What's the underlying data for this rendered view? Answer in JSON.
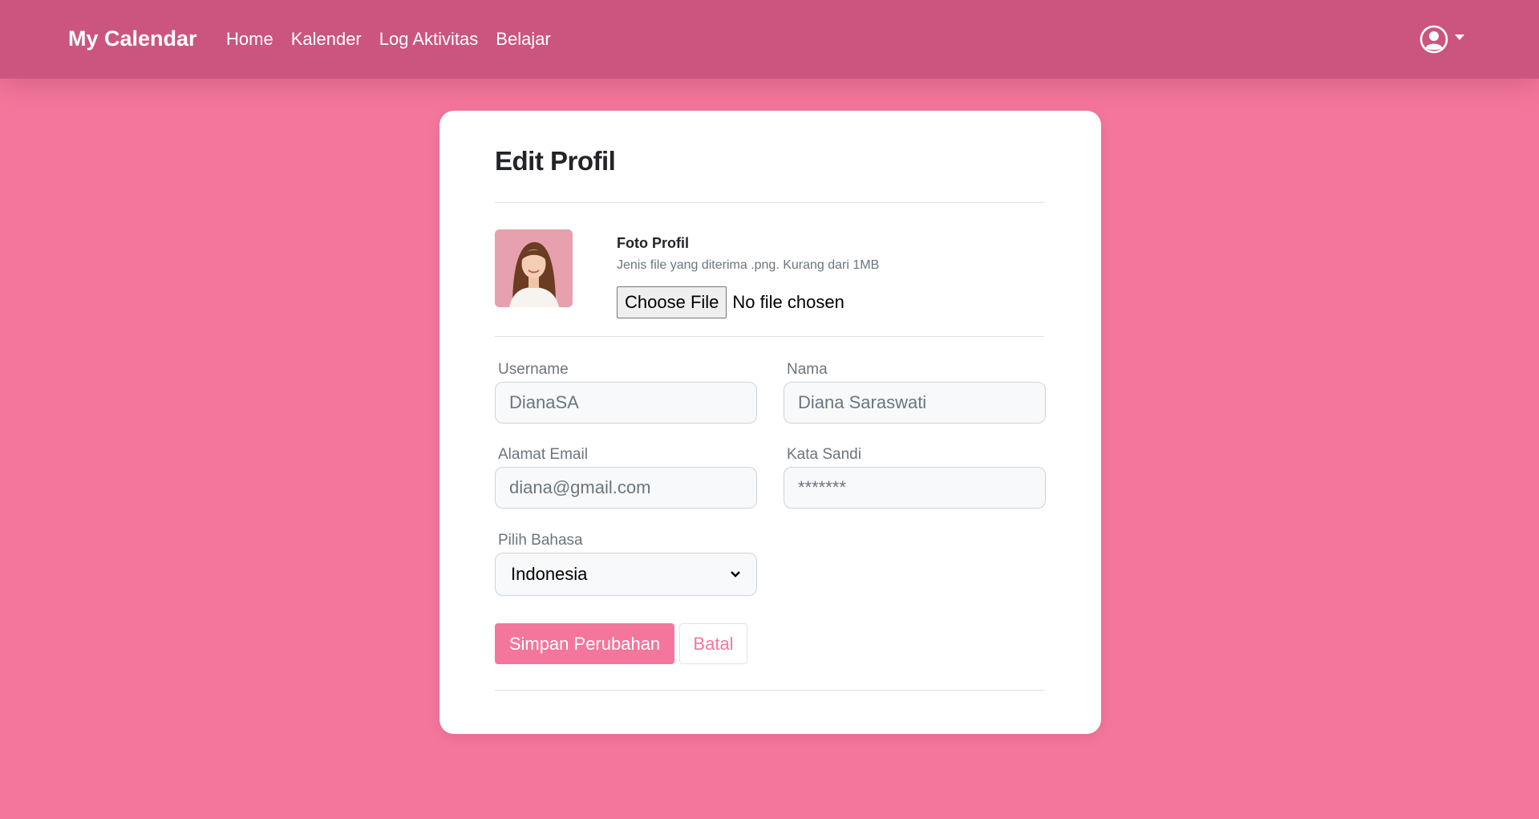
{
  "navbar": {
    "brand": "My Calendar",
    "links": [
      "Home",
      "Kalender",
      "Log Aktivitas",
      "Belajar"
    ],
    "user_icon": "user-circle-icon"
  },
  "card": {
    "title": "Edit Profil",
    "photo": {
      "label": "Foto Profil",
      "help": "Jenis file yang diterima .png. Kurang dari 1MB",
      "choose_button": "Choose File",
      "file_status": "No file chosen"
    },
    "fields": {
      "username": {
        "label": "Username",
        "value": "DianaSA"
      },
      "nama": {
        "label": "Nama",
        "value": "Diana Saraswati"
      },
      "email": {
        "label": "Alamat Email",
        "value": "diana@gmail.com"
      },
      "password": {
        "label": "Kata Sandi",
        "value": "*******"
      },
      "language": {
        "label": "Pilih Bahasa",
        "selected": "Indonesia"
      }
    },
    "buttons": {
      "save": "Simpan Perubahan",
      "cancel": "Batal"
    }
  },
  "colors": {
    "background": "#f4769c",
    "navbar": "#cb557e",
    "accent": "#f4769c"
  }
}
